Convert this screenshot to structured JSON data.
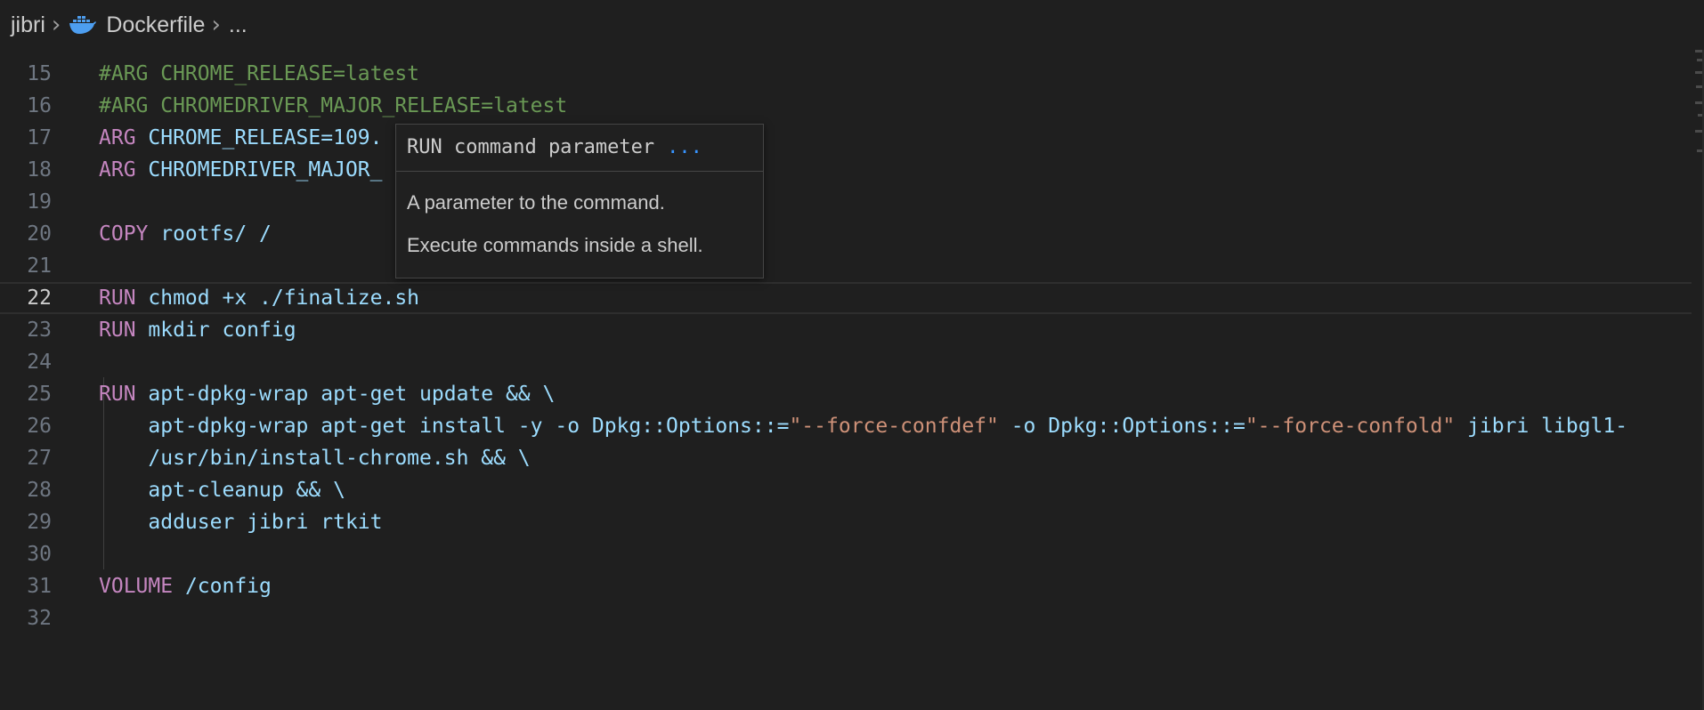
{
  "breadcrumb": {
    "folder": "jibri",
    "file": "Dockerfile",
    "more": "..."
  },
  "icons": {
    "chevron": "chevron-right-icon",
    "file_icon": "docker-icon"
  },
  "colors": {
    "keyword": "#c586c0",
    "comment": "#6a9955",
    "text": "#9cdcfe",
    "string": "#ce9178",
    "link": "#3794ff"
  },
  "editor": {
    "current_line": "22",
    "lines": [
      {
        "num": "15",
        "tokens": [
          {
            "t": "cm",
            "v": "#ARG CHROME_RELEASE=latest"
          }
        ]
      },
      {
        "num": "16",
        "tokens": [
          {
            "t": "cm",
            "v": "#ARG CHROMEDRIVER_MAJOR_RELEASE=latest"
          }
        ]
      },
      {
        "num": "17",
        "tokens": [
          {
            "t": "kw",
            "v": "ARG"
          },
          {
            "t": "txt",
            "v": " CHROME_RELEASE=109."
          }
        ]
      },
      {
        "num": "18",
        "tokens": [
          {
            "t": "kw",
            "v": "ARG"
          },
          {
            "t": "txt",
            "v": " CHROMEDRIVER_MAJOR_"
          }
        ]
      },
      {
        "num": "19",
        "tokens": []
      },
      {
        "num": "20",
        "tokens": [
          {
            "t": "kw",
            "v": "COPY"
          },
          {
            "t": "txt",
            "v": " rootfs/ /"
          }
        ]
      },
      {
        "num": "21",
        "tokens": []
      },
      {
        "num": "22",
        "tokens": [
          {
            "t": "kw",
            "v": "RUN"
          },
          {
            "t": "txt",
            "v": " chmod +x ./finalize.sh"
          }
        ]
      },
      {
        "num": "23",
        "tokens": [
          {
            "t": "kw",
            "v": "RUN"
          },
          {
            "t": "txt",
            "v": " mkdir config"
          }
        ]
      },
      {
        "num": "24",
        "tokens": []
      },
      {
        "num": "25",
        "tokens": [
          {
            "t": "kw",
            "v": "RUN"
          },
          {
            "t": "txt",
            "v": " apt-dpkg-wrap apt-get update && \\"
          }
        ]
      },
      {
        "num": "26",
        "tokens": [
          {
            "t": "txt",
            "v": "    apt-dpkg-wrap apt-get install -y -o Dpkg::Options::="
          },
          {
            "t": "str",
            "v": "\"--force-confdef\""
          },
          {
            "t": "txt",
            "v": " -o Dpkg::Options::="
          },
          {
            "t": "str",
            "v": "\"--force-confold\""
          },
          {
            "t": "txt",
            "v": " jibri libgl1-"
          }
        ]
      },
      {
        "num": "27",
        "tokens": [
          {
            "t": "txt",
            "v": "    /usr/bin/install-chrome.sh && \\"
          }
        ]
      },
      {
        "num": "28",
        "tokens": [
          {
            "t": "txt",
            "v": "    apt-cleanup && \\"
          }
        ]
      },
      {
        "num": "29",
        "tokens": [
          {
            "t": "txt",
            "v": "    adduser jibri rtkit"
          }
        ]
      },
      {
        "num": "30",
        "tokens": []
      },
      {
        "num": "31",
        "tokens": [
          {
            "t": "kw",
            "v": "VOLUME"
          },
          {
            "t": "txt",
            "v": " /config"
          }
        ]
      },
      {
        "num": "32",
        "tokens": []
      }
    ]
  },
  "hover": {
    "signature": "RUN command parameter",
    "more": "...",
    "description": "A parameter to the command.",
    "detail": "Execute commands inside a shell."
  }
}
